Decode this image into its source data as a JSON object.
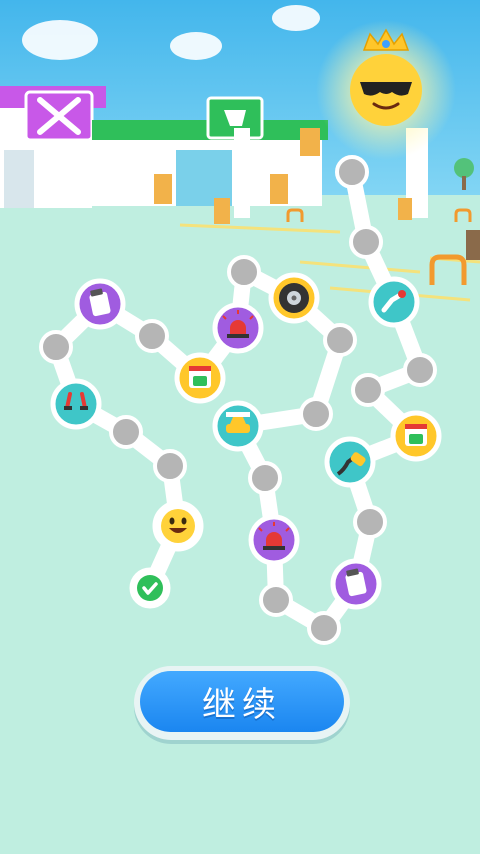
{
  "continue_button": {
    "label": "继续"
  },
  "colors": {
    "sky": "#56c4f0",
    "ground": "#bfeee0",
    "node_gray": "#b5b5b5",
    "path": "#ffffff",
    "button": "#2196f3",
    "check": "#2fbf5a"
  },
  "path_nodes": [
    {
      "type": "checkmark",
      "bg": "#ffffff",
      "state": "completed"
    },
    {
      "type": "smiley-icon",
      "bg": "#ffffff"
    },
    {
      "type": "empty"
    },
    {
      "type": "empty"
    },
    {
      "type": "jumper-cables-icon",
      "bg": "#3fc6c8"
    },
    {
      "type": "empty"
    },
    {
      "type": "fuel-can-icon",
      "bg": "#a05ce0"
    },
    {
      "type": "empty"
    },
    {
      "type": "car-wash-icon",
      "bg": "#ffc72a"
    },
    {
      "type": "siren-icon",
      "bg": "#a05ce0"
    },
    {
      "type": "empty"
    },
    {
      "type": "tire-icon",
      "bg": "#ffc72a"
    },
    {
      "type": "empty"
    },
    {
      "type": "empty"
    },
    {
      "type": "car-icon",
      "bg": "#3fc6c8"
    },
    {
      "type": "empty"
    },
    {
      "type": "siren-icon",
      "bg": "#a05ce0"
    },
    {
      "type": "empty"
    },
    {
      "type": "empty"
    },
    {
      "type": "fuel-can-icon",
      "bg": "#a05ce0"
    },
    {
      "type": "empty"
    },
    {
      "type": "fuel-nozzle-icon",
      "bg": "#3fc6c8"
    },
    {
      "type": "car-wash-icon",
      "bg": "#ffc72a"
    },
    {
      "type": "empty"
    },
    {
      "type": "empty"
    },
    {
      "type": "fuel-pump-icon",
      "bg": "#3fc6c8"
    },
    {
      "type": "empty"
    },
    {
      "type": "empty"
    },
    {
      "type": "sunglasses-sun-icon",
      "bg": "#ffd23a",
      "state": "goal"
    }
  ]
}
